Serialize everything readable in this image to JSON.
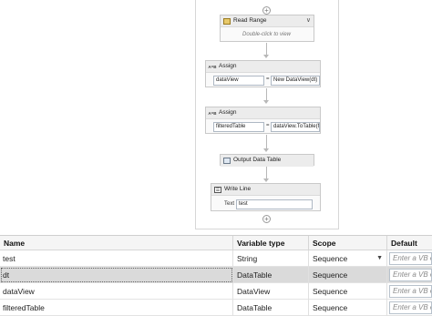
{
  "workflow": {
    "read_range": {
      "title": "Read Range",
      "hint": "Double-click to view"
    },
    "assign_1": {
      "title": "Assign",
      "to": "dataView",
      "value": "New DataView(dt)"
    },
    "assign_2": {
      "title": "Assign",
      "to": "filteredTable",
      "value": "dataView.ToTable(f"
    },
    "output_data_table": {
      "title": "Output Data Table"
    },
    "write_line": {
      "title": "Write Line",
      "text_label": "Text",
      "text_value": "test"
    },
    "assign_icon_text": "A=B",
    "plus_symbol": "+"
  },
  "variables": {
    "headers": {
      "name": "Name",
      "type": "Variable type",
      "scope": "Scope",
      "default": "Default"
    },
    "default_placeholder": "Enter a VB expression",
    "rows": [
      {
        "name": "test",
        "type": "String",
        "scope": "Sequence"
      },
      {
        "name": "dt",
        "type": "DataTable",
        "scope": "Sequence",
        "selected": true
      },
      {
        "name": "dataView",
        "type": "DataView",
        "scope": "Sequence"
      },
      {
        "name": "filteredTable",
        "type": "DataTable",
        "scope": "Sequence"
      }
    ]
  },
  "colors": {
    "selected_row": "#dadada",
    "activity_header": "#ececec",
    "field_border": "#aeb8c4"
  }
}
